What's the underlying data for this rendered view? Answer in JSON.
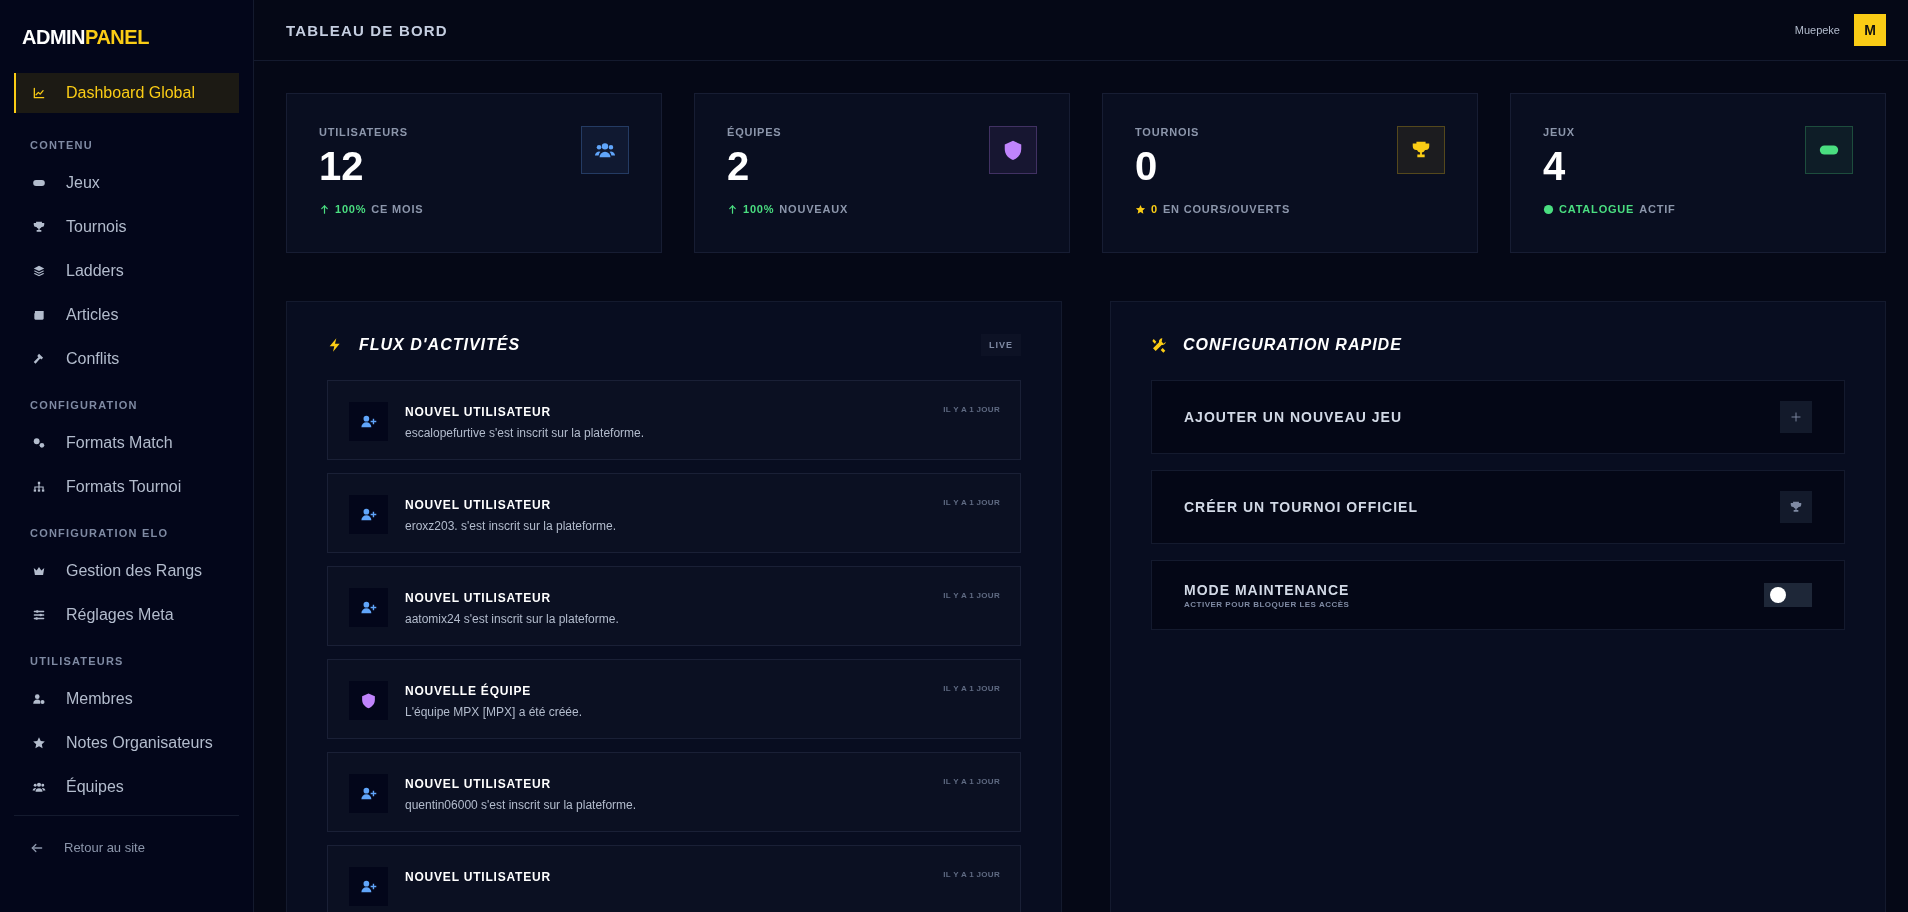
{
  "sidebar": {
    "logo": {
      "first": "ADMIN",
      "second": "PANEL"
    },
    "top_item": {
      "label": "Dashboard Global",
      "selected": true
    },
    "sections": [
      {
        "heading": "CONTENU",
        "items": [
          {
            "label": "Jeux",
            "selected": false
          },
          {
            "label": "Tournois",
            "selected": false
          },
          {
            "label": "Ladders",
            "selected": false
          },
          {
            "label": "Articles",
            "selected": false
          },
          {
            "label": "Conflits",
            "selected": false
          }
        ]
      },
      {
        "heading": "CONFIGURATION",
        "items": [
          {
            "label": "Formats Match",
            "selected": false
          },
          {
            "label": "Formats Tournoi",
            "selected": false
          }
        ]
      },
      {
        "heading": "CONFIGURATION ELO",
        "items": [
          {
            "label": "Gestion des Rangs",
            "selected": false
          },
          {
            "label": "Réglages Meta",
            "selected": false
          }
        ]
      },
      {
        "heading": "UTILISATEURS",
        "items": [
          {
            "label": "Membres",
            "selected": false
          },
          {
            "label": "Notes Organisateurs",
            "selected": false
          },
          {
            "label": "Équipes",
            "selected": false
          }
        ]
      }
    ],
    "footer_link": "Retour au site"
  },
  "header": {
    "title": "TABLEAU DE BORD",
    "user": "Muepeke",
    "avatar": "M"
  },
  "stats": [
    {
      "kind": "up",
      "label": "UTILISATEURS",
      "value": "12",
      "color": "#60a5fa",
      "note_strong": "100%",
      "note": "CE MOIS"
    },
    {
      "kind": "up",
      "label": "ÉQUIPES",
      "value": "2",
      "color": "#c084fc",
      "note_strong": "100%",
      "note": "NOUVEAUX"
    },
    {
      "kind": "star",
      "label": "TOURNOIS",
      "value": "0",
      "color": "#facc15",
      "note_strong": "0",
      "note": "EN COURS/OUVERTS"
    },
    {
      "kind": "check",
      "label": "JEUX",
      "value": "4",
      "color": "#4ade80",
      "note_strong": "CATALOGUE",
      "note": "ACTIF"
    }
  ],
  "activity": {
    "title": "FLUX D'ACTIVITÉS",
    "badge": "LIVE",
    "items": [
      {
        "kind": "user",
        "title": "NOUVEL UTILISATEUR",
        "text": "escalopefurtive s'est inscrit sur la plateforme.",
        "time": "IL Y A 1 JOUR"
      },
      {
        "kind": "user",
        "title": "NOUVEL UTILISATEUR",
        "text": "eroxz203. s'est inscrit sur la plateforme.",
        "time": "IL Y A 1 JOUR"
      },
      {
        "kind": "user",
        "title": "NOUVEL UTILISATEUR",
        "text": "aatomix24 s'est inscrit sur la plateforme.",
        "time": "IL Y A 1 JOUR"
      },
      {
        "kind": "team",
        "title": "NOUVELLE ÉQUIPE",
        "text": "L'équipe MPX [MPX] a été créée.",
        "time": "IL Y A 1 JOUR"
      },
      {
        "kind": "user",
        "title": "NOUVEL UTILISATEUR",
        "text": "quentin06000 s'est inscrit sur la plateforme.",
        "time": "IL Y A 1 JOUR"
      },
      {
        "kind": "user",
        "title": "NOUVEL UTILISATEUR",
        "time": "IL Y A 1 JOUR"
      }
    ]
  },
  "config": {
    "title": "CONFIGURATION RAPIDE",
    "items": [
      {
        "kind": "button",
        "label": "AJOUTER UN NOUVEAU JEU"
      },
      {
        "kind": "button",
        "label": "CRÉER UN TOURNOI OFFICIEL"
      },
      {
        "kind": "toggle",
        "label": "MODE MAINTENANCE",
        "sub": "ACTIVER POUR BLOQUER LES ACCÈS",
        "on": false
      }
    ]
  }
}
